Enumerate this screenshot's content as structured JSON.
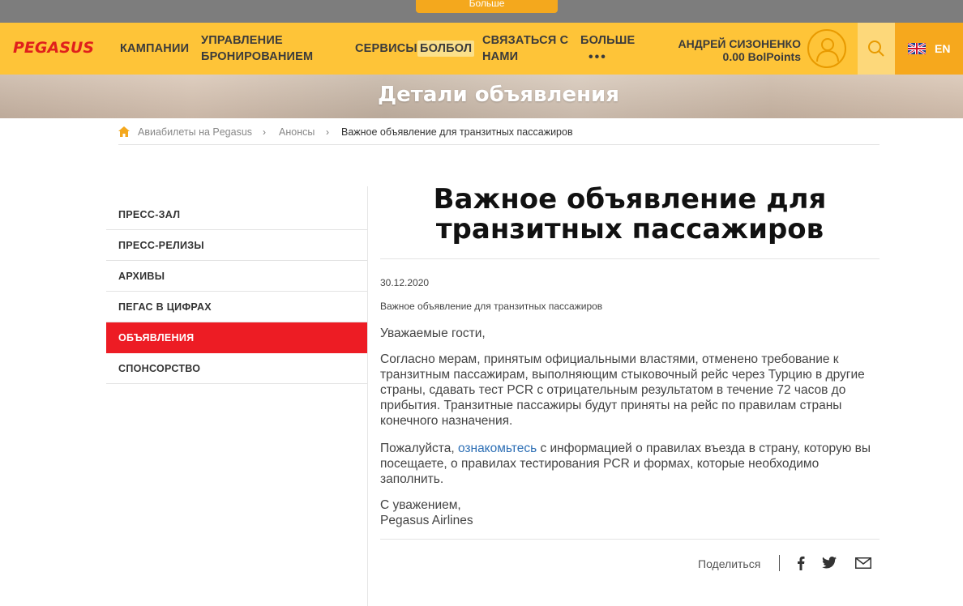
{
  "top_strip": {
    "more_label": "Больше"
  },
  "header": {
    "logo": "PEGASUS",
    "nav": {
      "campaigns": "КАМПАНИИ",
      "manage_line1": "УПРАВЛЕНИЕ",
      "manage_line2": "БРОНИРОВАНИЕМ",
      "services": "СЕРВИСЫ",
      "bolbol": "БОЛБОЛ",
      "contact_line1": "СВЯЗАТЬСЯ С",
      "contact_line2": "НАМИ",
      "more": "БОЛЬШЕ",
      "more_dots": "•••"
    },
    "user": {
      "name": "АНДРЕЙ СИЗОНЕНКО",
      "points": "0.00 BolPoints"
    },
    "language": "EN"
  },
  "hero": {
    "title": "Детали объявления"
  },
  "breadcrumb": {
    "home": "Авиабилеты на Pegasus",
    "section": "Анонсы",
    "current": "Важное объявление для транзитных пассажиров",
    "separator": "›"
  },
  "sidebar": {
    "items": [
      {
        "label": "ПРЕСС-ЗАЛ"
      },
      {
        "label": "ПРЕСС-РЕЛИЗЫ"
      },
      {
        "label": "АРХИВЫ"
      },
      {
        "label": "ПЕГАС В ЦИФРАХ"
      },
      {
        "label": "ОБЪЯВЛЕНИЯ",
        "active": true
      },
      {
        "label": "СПОНСОРСТВО"
      }
    ]
  },
  "article": {
    "title_line1": "Важное объявление для",
    "title_line2": "транзитных пассажиров",
    "date": "30.12.2020",
    "subtitle": "Важное объявление для транзитных пассажиров",
    "greeting": "Уважаемые гости,",
    "paragraph1": "Согласно мерам, принятым официальными властями, отменено требование к транзитным пассажирам, выполняющим стыковочный рейс через Турцию в другие страны, сдавать тест PCR с отрицательным результатом в течение 72 часов до прибытия. Транзитные пассажиры будут приняты на рейс по правилам страны конечного назначения.",
    "paragraph2_before": "Пожалуйста,",
    "paragraph2_link": "ознакомьтесь",
    "paragraph2_after": "с информацией о правилах въезда в страну, которую вы посещаете, о правилах тестирования PCR и формах, которые необходимо заполнить.",
    "closing_line1": "С уважением,",
    "closing_line2": "Pegasus Airlines"
  },
  "share": {
    "label": "Поделиться"
  },
  "colors": {
    "header": "#fec438",
    "accent_red": "#ed1c24",
    "lang_bg": "#f6a81d",
    "link": "#2d6fb5"
  }
}
